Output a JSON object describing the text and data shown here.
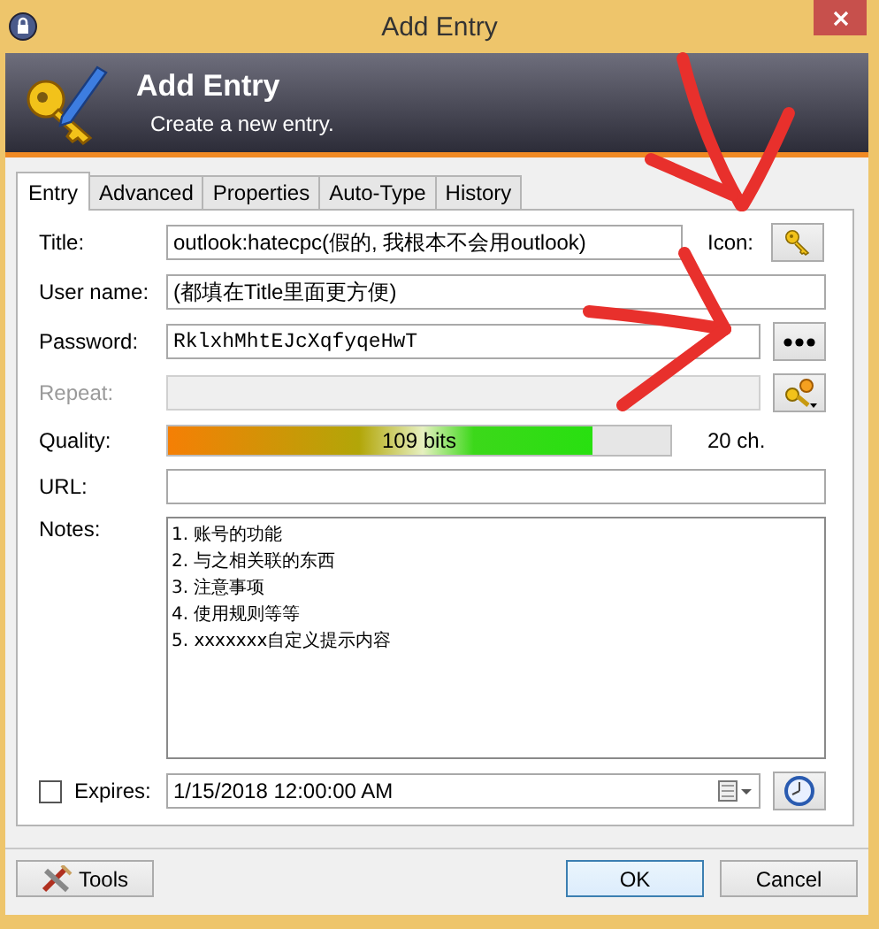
{
  "window": {
    "title": "Add Entry"
  },
  "header": {
    "title": "Add Entry",
    "subtitle": "Create a new entry."
  },
  "tabs": [
    {
      "label": "Entry",
      "selected": true
    },
    {
      "label": "Advanced",
      "selected": false
    },
    {
      "label": "Properties",
      "selected": false
    },
    {
      "label": "Auto-Type",
      "selected": false
    },
    {
      "label": "History",
      "selected": false
    }
  ],
  "title_field": {
    "label": "Title:",
    "value": "outlook:hatecpc(假的, 我根本不会用outlook)"
  },
  "icon": {
    "label": "Icon:"
  },
  "user_name": {
    "label": "User name:",
    "value": "(都填在Title里面更方便)"
  },
  "password": {
    "label": "Password:",
    "value": "RklxhMhtEJcXqfyqeHwT"
  },
  "repeat": {
    "label": "Repeat:",
    "disabled": true
  },
  "quality": {
    "label": "Quality:",
    "level": 0.846,
    "reading": "109 bits",
    "length": "20 ch."
  },
  "url": {
    "label": "URL:"
  },
  "notes": {
    "label": "Notes:",
    "lines": [
      "1. 账号的功能",
      "2. 与之相关联的东西",
      "3. 注意事项",
      "4. 使用规则等等",
      "5. xxxxxxx自定义提示内容"
    ]
  },
  "expires": {
    "label": "Expires:",
    "checked": false,
    "value": "1/15/2018 12:00:00 AM"
  },
  "buttons": [
    {
      "label": "Tools",
      "kind": "tools",
      "default": false
    },
    {
      "label": "OK",
      "kind": "plain",
      "default": true
    },
    {
      "label": "Cancel",
      "kind": "plain",
      "default": false
    }
  ]
}
